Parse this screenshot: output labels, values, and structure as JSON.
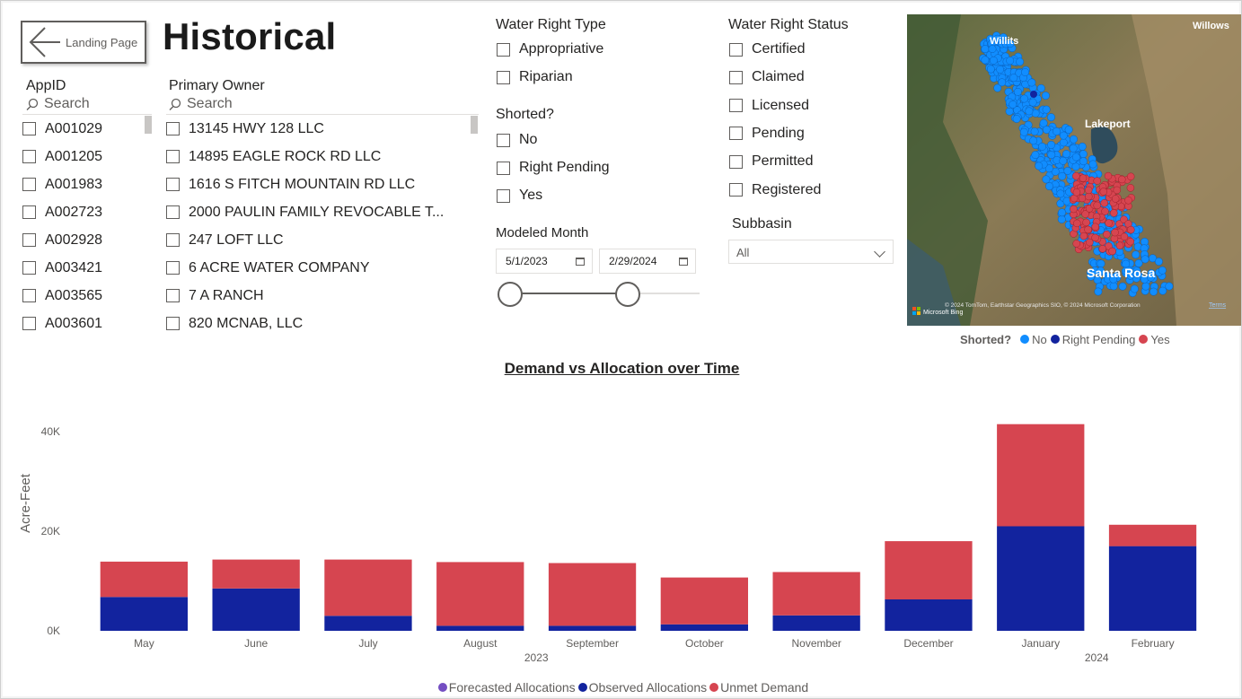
{
  "nav": {
    "back_label": "Landing Page"
  },
  "page_title": "Historical",
  "appid_slicer": {
    "title": "AppID",
    "search_placeholder": "Search",
    "items": [
      "A001029",
      "A001205",
      "A001983",
      "A002723",
      "A002928",
      "A003421",
      "A003565",
      "A003601"
    ]
  },
  "owner_slicer": {
    "title": "Primary Owner",
    "search_placeholder": "Search",
    "items": [
      "13145 HWY 128 LLC",
      "14895 EAGLE ROCK RD LLC",
      "1616 S FITCH MOUNTAIN RD LLC",
      "2000 PAULIN FAMILY REVOCABLE T...",
      "247 LOFT LLC",
      "6 ACRE WATER COMPANY",
      "7 A RANCH",
      "820 MCNAB, LLC"
    ]
  },
  "water_right_type": {
    "title": "Water Right Type",
    "items": [
      "Appropriative",
      "Riparian"
    ]
  },
  "shorted": {
    "title": "Shorted?",
    "items": [
      "No",
      "Right Pending",
      "Yes"
    ]
  },
  "modeled_month": {
    "title": "Modeled Month",
    "start": "5/1/2023",
    "end": "2/29/2024"
  },
  "water_right_status": {
    "title": "Water Right Status",
    "items": [
      "Certified",
      "Claimed",
      "Licensed",
      "Pending",
      "Permitted",
      "Registered"
    ]
  },
  "subbasin": {
    "title": "Subbasin",
    "value": "All"
  },
  "map": {
    "labels": {
      "willits": "Willits",
      "willows": "Willows",
      "lakeport": "Lakeport",
      "santa_rosa": "Santa Rosa"
    },
    "attribution": "© 2024 TomTom, Earthstar Geographics SIO, © 2024 Microsoft Corporation",
    "terms": "Terms",
    "bing": "Microsoft Bing",
    "legend_title": "Shorted?",
    "legend": [
      {
        "label": "No",
        "color": "#118DFF"
      },
      {
        "label": "Right Pending",
        "color": "#12239E"
      },
      {
        "label": "Yes",
        "color": "#D64550"
      }
    ]
  },
  "chart_data": {
    "type": "bar",
    "stacked": true,
    "title": "Demand vs Allocation over Time",
    "xlabel": "",
    "ylabel": "Acre-Feet",
    "ylim": [
      0,
      45000
    ],
    "yticks": [
      "0K",
      "20K",
      "40K"
    ],
    "ytick_values": [
      0,
      20000,
      40000
    ],
    "categories": [
      "May",
      "June",
      "July",
      "August",
      "September",
      "October",
      "November",
      "December",
      "January",
      "February"
    ],
    "year_labels": [
      {
        "label": "2023",
        "category_index": 3.5
      },
      {
        "label": "2024",
        "category_index": 8.5
      }
    ],
    "series": [
      {
        "name": "Forecasted Allocations",
        "color": "#744EC2",
        "values": [
          0,
          0,
          0,
          0,
          0,
          0,
          0,
          0,
          0,
          0
        ]
      },
      {
        "name": "Observed Allocations",
        "color": "#12239E",
        "values": [
          6800,
          8500,
          3000,
          1000,
          1000,
          1300,
          3100,
          6300,
          21000,
          17000
        ]
      },
      {
        "name": "Unmet Demand",
        "color": "#D64550",
        "values": [
          7100,
          5800,
          11300,
          12800,
          12600,
          9400,
          8700,
          11700,
          20500,
          4300
        ]
      }
    ],
    "legend_position": "bottom",
    "grid": false
  }
}
